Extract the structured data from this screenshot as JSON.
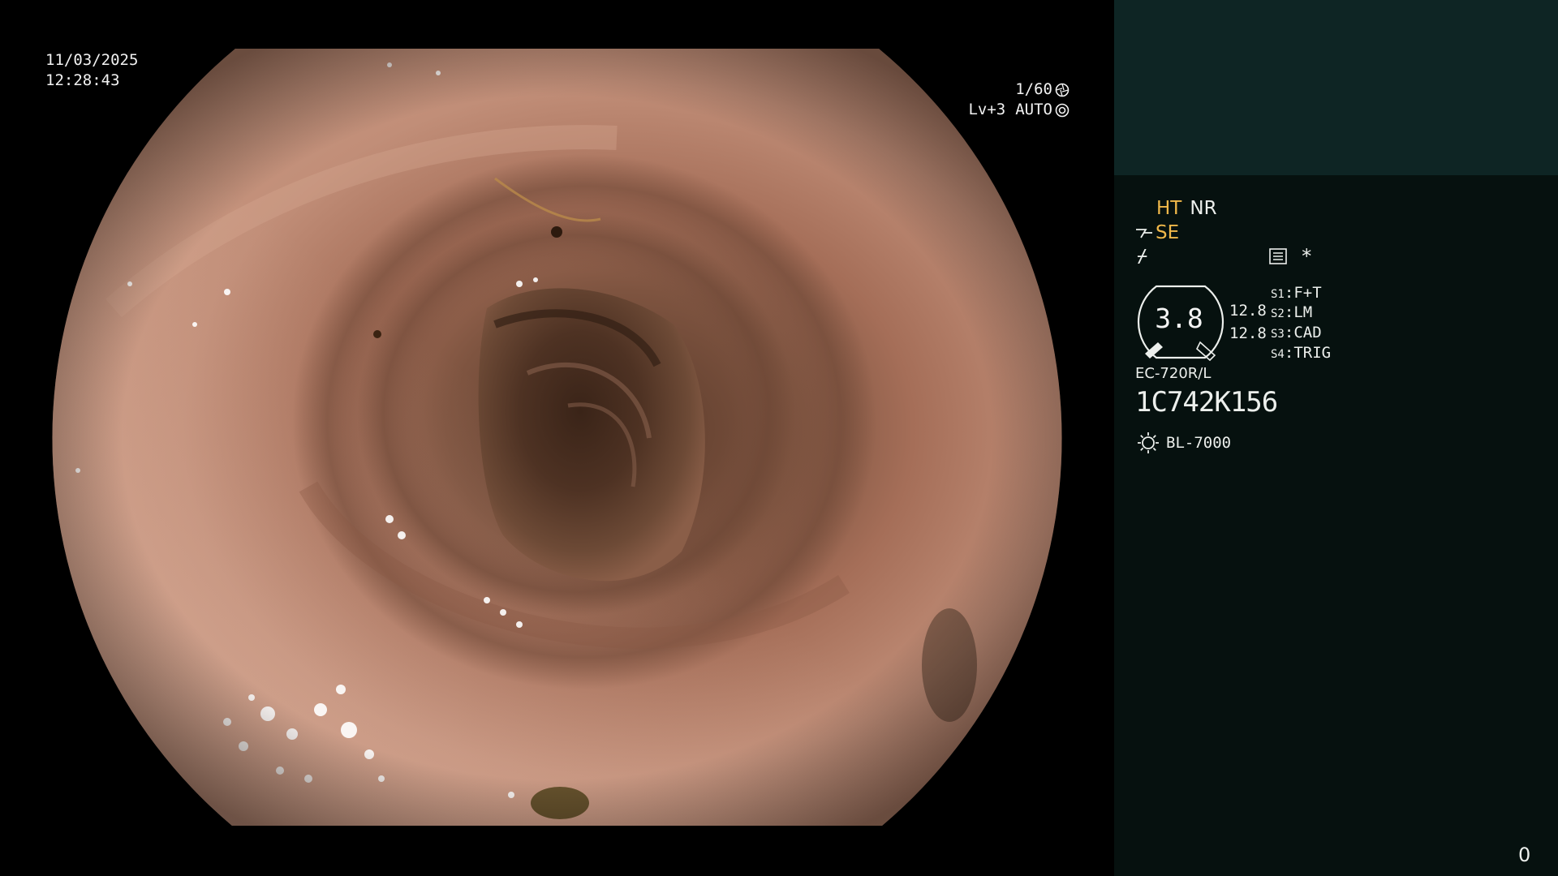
{
  "osd": {
    "date": "11/03/2025",
    "time": "12:28:43",
    "shutter": "1/60",
    "shutter_icon": "aperture-icon",
    "iris_level": "Lv+3",
    "iris_mode": "AUTO",
    "iris_icon": "iris-icon"
  },
  "panel": {
    "mode_ht": "HT",
    "mode_nr": "NR",
    "enhance_mode": "SE",
    "enhance_icon": "structure-enhance-icon",
    "slash_symbol": "⌿",
    "record_icon": "recording-icon",
    "star": "*",
    "zoom_value": "3.8",
    "zoom_side_1": "12.8",
    "zoom_side_2": "12.8",
    "switches": [
      {
        "key": "S1",
        "value": "F+T"
      },
      {
        "key": "S2",
        "value": "LM"
      },
      {
        "key": "S3",
        "value": "CAD"
      },
      {
        "key": "S4",
        "value": "TRIG"
      }
    ],
    "scope_model": "EC-720R/L",
    "scope_serial": "1C742K156",
    "light_icon": "light-source-icon",
    "light_source": "BL-7000",
    "frame_counter": "0"
  },
  "colors": {
    "background": "#000000",
    "panel_bg": "#06110f",
    "panel_top_bg": "#0e2524",
    "accent_amber": "#f0b84a",
    "text": "#ecefec"
  }
}
